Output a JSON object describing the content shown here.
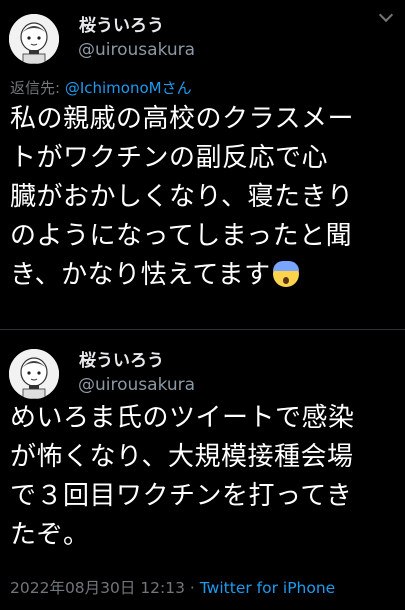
{
  "tweets": [
    {
      "display_name": "桜ういろう",
      "handle": "@uirousakura",
      "reply_to_label": "返信先: ",
      "reply_to_user": "@IchimonoMさん",
      "text": "私の親戚の高校のクラスメー\nトがワクチンの副反応で心\n臓がおかしくなり、寝たきり\nのようになってしまったと聞\nき、かなり怯えてます",
      "emoji": "fearful-face"
    },
    {
      "display_name": "桜ういろう",
      "handle": "@uirousakura",
      "text": "めいろま氏のツイートで感染\nが怖くなり、大規模接種会場\nで３回目ワクチンを打ってき\nたぞ。",
      "timestamp": "2022年08月30日 12:13",
      "separator": " · ",
      "source": "Twitter for iPhone"
    }
  ],
  "colors": {
    "background": "#000000",
    "text": "#ffffff",
    "secondary": "#71767b",
    "link": "#1d9bf0"
  }
}
